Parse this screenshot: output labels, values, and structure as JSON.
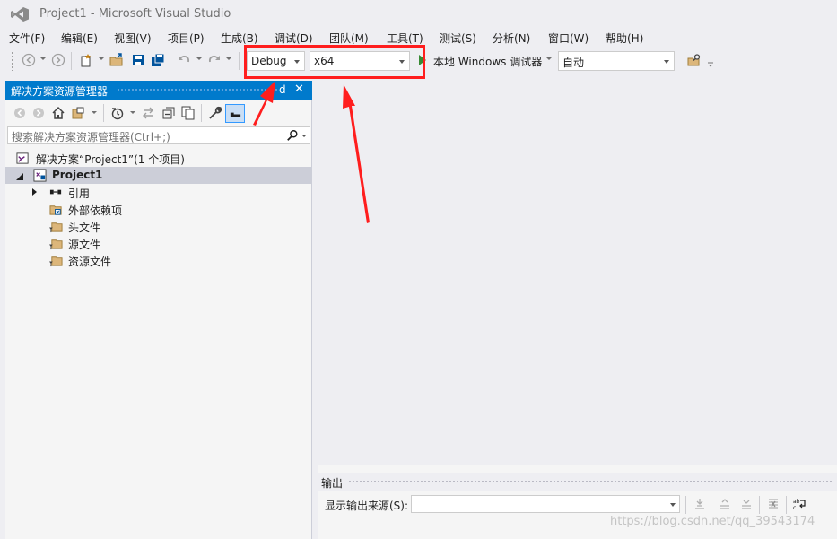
{
  "window": {
    "title": "Project1 - Microsoft Visual Studio",
    "logo_icon": "visual-studio-logo-icon"
  },
  "menu": [
    {
      "label": "文件(F)"
    },
    {
      "label": "编辑(E)"
    },
    {
      "label": "视图(V)"
    },
    {
      "label": "项目(P)"
    },
    {
      "label": "生成(B)"
    },
    {
      "label": "调试(D)"
    },
    {
      "label": "团队(M)"
    },
    {
      "label": "工具(T)"
    },
    {
      "label": "测试(S)"
    },
    {
      "label": "分析(N)"
    },
    {
      "label": "窗口(W)"
    },
    {
      "label": "帮助(H)"
    }
  ],
  "toolbar": {
    "configuration": "Debug",
    "platform": "x64",
    "debugger": "本地 Windows 调试器",
    "debugger_mode": "自动",
    "start_icon": "play-icon"
  },
  "solution_explorer": {
    "title": "解决方案资源管理器",
    "search_placeholder": "搜索解决方案资源管理器(Ctrl+;)",
    "tree": {
      "solution": "解决方案“Project1”(1 个项目)",
      "project": "Project1",
      "items": [
        {
          "label": "引用",
          "icon": "references-icon"
        },
        {
          "label": "外部依赖项",
          "icon": "external-dependencies-icon"
        },
        {
          "label": "头文件",
          "icon": "folder-filter-icon"
        },
        {
          "label": "源文件",
          "icon": "folder-filter-icon"
        },
        {
          "label": "资源文件",
          "icon": "folder-filter-icon"
        }
      ]
    }
  },
  "output": {
    "title": "输出",
    "source_label": "显示输出来源(S):",
    "source_value": ""
  },
  "annotation": {
    "highlight_color": "#ff1e1e"
  },
  "watermark": "https://blog.csdn.net/qq_39543174",
  "colors": {
    "accent": "#007acc",
    "background": "#eeeef2",
    "selection": "#ccced8"
  }
}
